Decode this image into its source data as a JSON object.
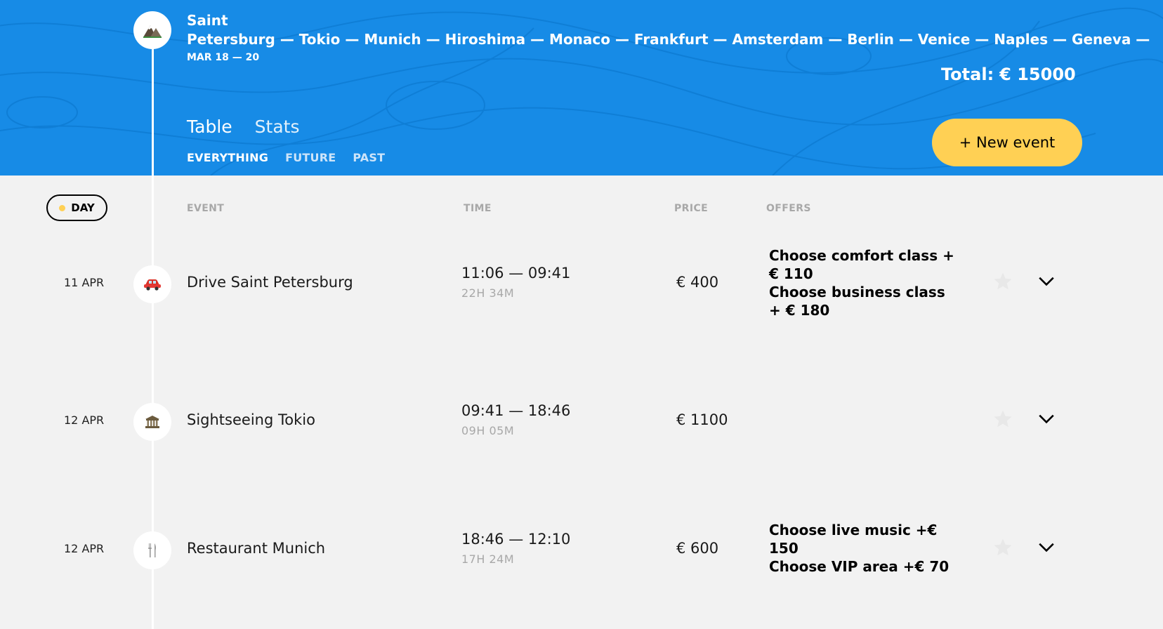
{
  "trip": {
    "route_first": "Saint",
    "route_rest": "Petersburg — Tokio — Munich — Hiroshima — Monaco — Frankfurt — Amsterdam — Berlin — Venice — Naples — Geneva —",
    "dates": "MAR 18 — 20",
    "total_label": "Total:",
    "total_value": "€ 15000",
    "icon": "mountain-icon"
  },
  "view_tabs": [
    "Table",
    "Stats"
  ],
  "filters": [
    "EVERYTHING",
    "FUTURE",
    "PAST"
  ],
  "new_event_label": "+ New event",
  "table": {
    "sort_label": "DAY",
    "columns": {
      "event": "EVENT",
      "time": "TIME",
      "price": "PRICE",
      "offers": "OFFERS"
    }
  },
  "events": [
    {
      "date": "11 APR",
      "icon": "car-icon",
      "name": "Drive Saint Petersburg",
      "time": "11:06 — 09:41",
      "duration": "22H 34M",
      "price": "€ 400",
      "offers": [
        "Choose comfort class + €  110",
        "Choose business class + €  180"
      ]
    },
    {
      "date": "12 APR",
      "icon": "museum-icon",
      "name": "Sightseeing Tokio",
      "time": "09:41 — 18:46",
      "duration": "09H 05M",
      "price": "€ 1100",
      "offers": []
    },
    {
      "date": "12 APR",
      "icon": "fork-knife-icon",
      "name": "Restaurant Munich",
      "time": "18:46 — 12:10",
      "duration": "17H 24M",
      "price": "€ 600",
      "offers": [
        "Choose live music +€  150",
        "Choose VIP area +€  70"
      ]
    }
  ],
  "colors": {
    "header_bg": "#178be6",
    "accent_yellow": "#ffd054",
    "page_bg": "#f2f2f2",
    "muted_text": "#a8a8a8"
  }
}
